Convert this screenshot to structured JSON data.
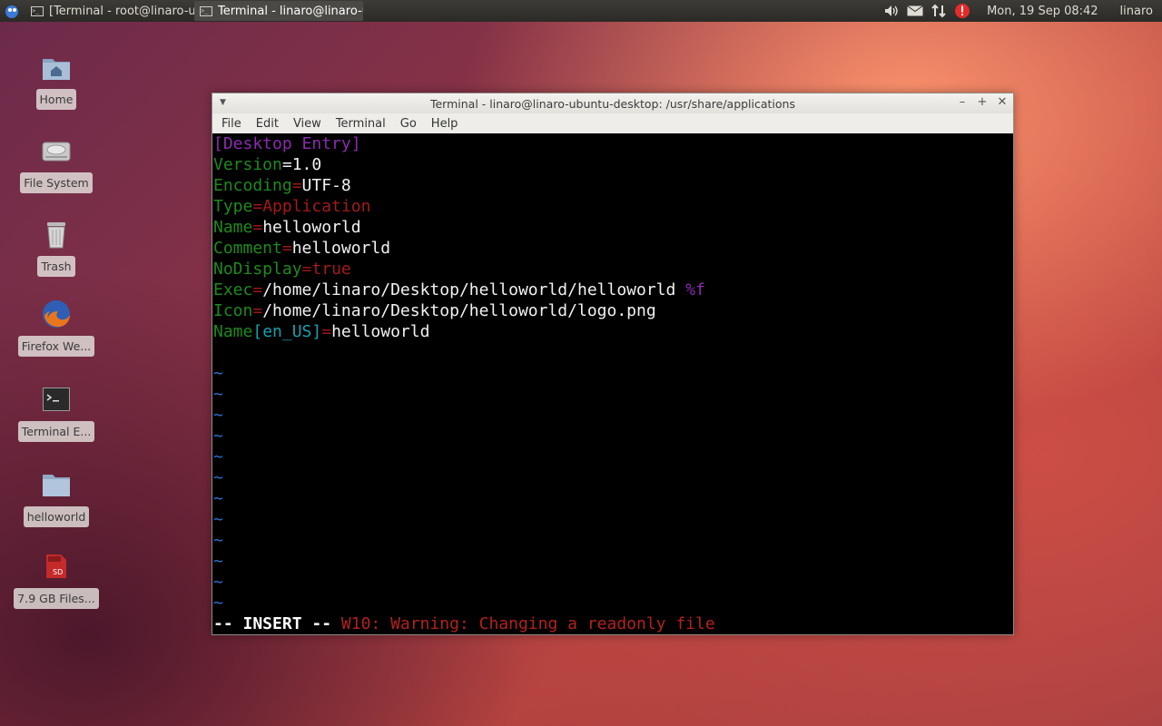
{
  "panel": {
    "tasks": [
      {
        "label": "[Terminal - root@linaro-ubu..."
      },
      {
        "label": "Terminal - linaro@linaro-ub..."
      }
    ],
    "clock": "Mon, 19 Sep  08:42",
    "user": "linaro",
    "colors": {
      "panel_bg": "#2b2a26",
      "notification_red": "#e52a2a"
    }
  },
  "desktop": {
    "icons": [
      {
        "label": "Home",
        "icon": "home-folder-icon"
      },
      {
        "label": "File System",
        "icon": "hard-drive-icon"
      },
      {
        "label": "Trash",
        "icon": "trash-icon"
      },
      {
        "label": "Firefox We...",
        "icon": "firefox-icon"
      },
      {
        "label": "Terminal E...",
        "icon": "terminal-icon"
      },
      {
        "label": "helloworld",
        "icon": "folder-icon"
      },
      {
        "label": "7.9 GB Files...",
        "icon": "sd-card-icon"
      }
    ]
  },
  "window": {
    "title": "Terminal - linaro@linaro-ubuntu-desktop: /usr/share/applications",
    "menu": [
      "File",
      "Edit",
      "View",
      "Terminal",
      "Go",
      "Help"
    ]
  },
  "editor": {
    "section": "[Desktop Entry]",
    "entries": [
      {
        "key": "Version",
        "sep": "=",
        "value": "1.0"
      },
      {
        "key": "Encoding",
        "sep": "=",
        "value": "UTF-8"
      },
      {
        "key": "Type",
        "sep": "=",
        "value": "Application"
      },
      {
        "key": "Name",
        "sep": "=",
        "value": "helloworld"
      },
      {
        "key": "Comment",
        "sep": "=",
        "value": "helloworld"
      },
      {
        "key": "NoDisplay",
        "sep": "=",
        "value": "true"
      },
      {
        "key": "Exec",
        "sep": "=",
        "value": "/home/linaro/Desktop/helloworld/helloworld",
        "extra": "%f"
      },
      {
        "key": "Icon",
        "sep": "=",
        "value": "/home/linaro/Desktop/helloworld/logo.png"
      },
      {
        "key": "Name",
        "locale": "[en_US]",
        "sep": "=",
        "value": "helloworld"
      }
    ],
    "tilde": "~",
    "mode": "-- INSERT --",
    "warning": "W10: Warning: Changing a readonly file"
  }
}
